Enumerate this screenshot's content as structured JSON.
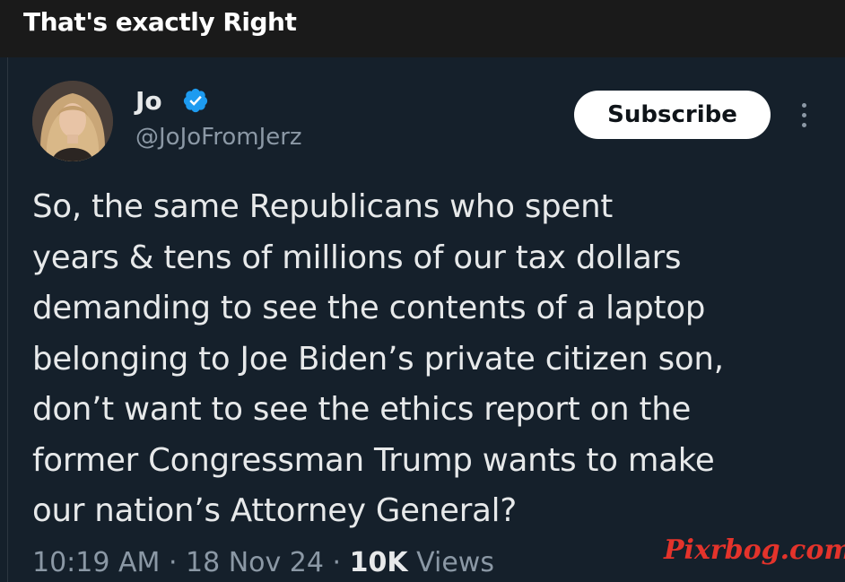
{
  "header": {
    "title": "That's exactly Right"
  },
  "tweet": {
    "author": {
      "name": "Jo",
      "handle": "@JoJoFromJerz",
      "verified_icon": "verified-badge-icon"
    },
    "subscribe_label": "Subscribe",
    "more_icon": "more-options-icon",
    "text": "So, the same Republicans who spent\nyears & tens of millions of our tax dollars\ndemanding to see the contents of a laptop\nbelonging to Joe Biden’s private citizen son,\ndon’t want to see the ethics report on the\nformer Congressman Trump wants to make\nour nation’s Attorney General?",
    "time": "10:19 AM",
    "sep1": " · ",
    "date": "18 Nov 24",
    "sep2": " · ",
    "views_count": "10K",
    "views_label": " Views"
  },
  "watermark": "Pixrbog.com",
  "colors": {
    "background": "#15202b",
    "header_bar": "#1a1a1a",
    "text_primary": "#e7e9ea",
    "text_secondary": "#8b98a5",
    "verified_blue": "#1d9bf0",
    "watermark_red": "#e4332b"
  }
}
